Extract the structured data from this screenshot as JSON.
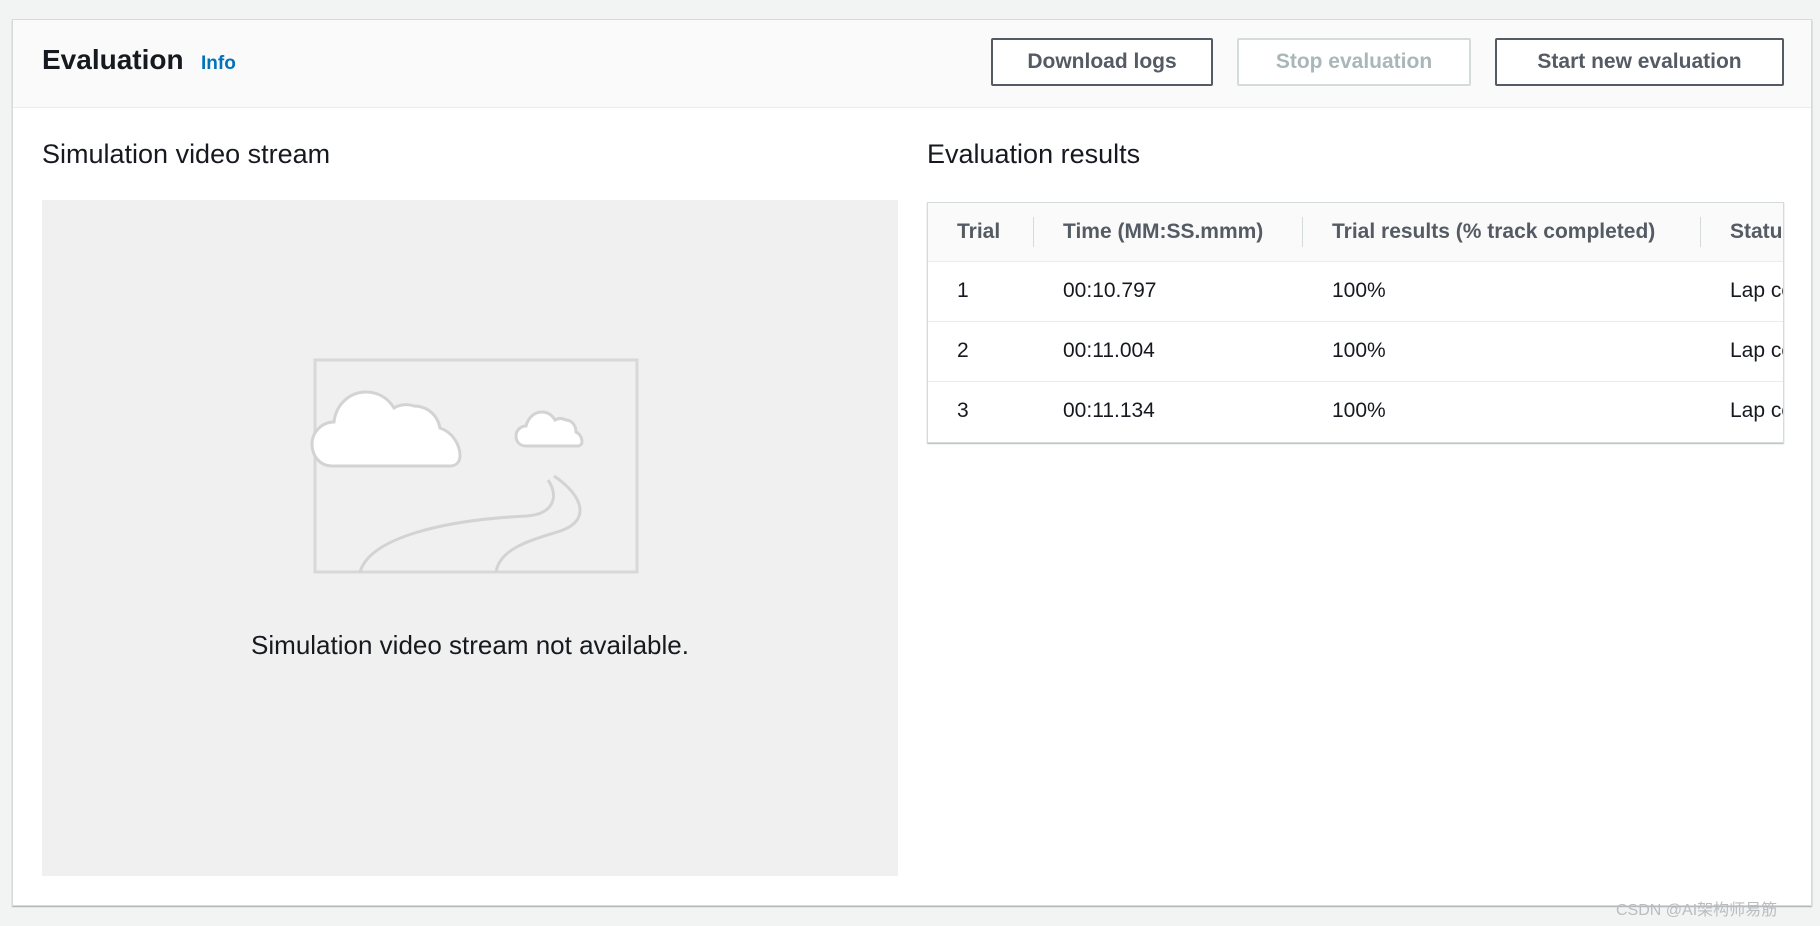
{
  "header": {
    "title": "Evaluation",
    "info_label": "Info",
    "buttons": {
      "download_logs": "Download logs",
      "stop_evaluation": "Stop evaluation",
      "start_new_evaluation": "Start new evaluation"
    }
  },
  "video": {
    "title": "Simulation video stream",
    "message": "Simulation video stream not available."
  },
  "results": {
    "title": "Evaluation results",
    "columns": [
      "Trial",
      "Time (MM:SS.mmm)",
      "Trial results (% track completed)",
      "Status"
    ],
    "rows": [
      {
        "trial": "1",
        "time": "00:10.797",
        "result": "100%",
        "status": "Lap complete"
      },
      {
        "trial": "2",
        "time": "00:11.004",
        "result": "100%",
        "status": "Lap complete"
      },
      {
        "trial": "3",
        "time": "00:11.134",
        "result": "100%",
        "status": "Lap complete"
      }
    ]
  },
  "watermark": "CSDN @AI架构师易筋",
  "colors": {
    "link": "#0073bb",
    "button_border": "#545b64",
    "disabled": "#aab7b8",
    "video_bg": "#f0f0f0"
  }
}
